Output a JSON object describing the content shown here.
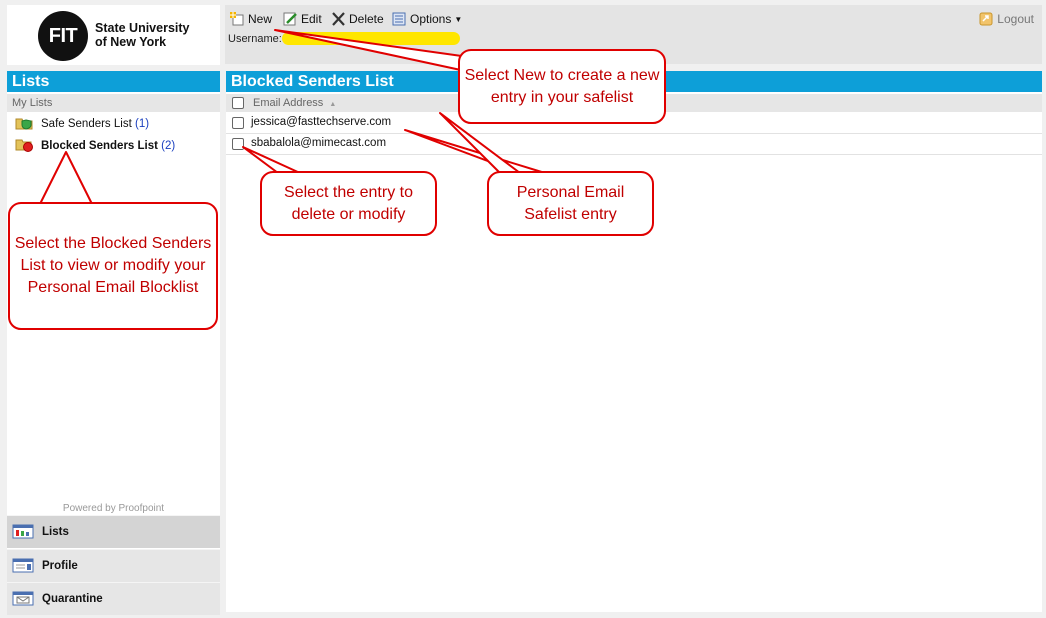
{
  "logo": {
    "mark": "FIT",
    "line1": "State University",
    "line2": "of New York"
  },
  "toolbar": {
    "new_label": "New",
    "edit_label": "Edit",
    "delete_label": "Delete",
    "options_label": "Options",
    "logout_label": "Logout",
    "username_label": "Username:"
  },
  "sidebar": {
    "title": "Lists",
    "section_label": "My Lists",
    "items": [
      {
        "label": "Safe Senders List",
        "count": "(1)",
        "icon": "shield-folder-icon"
      },
      {
        "label": "Blocked Senders List",
        "count": "(2)",
        "icon": "blocked-folder-icon"
      }
    ],
    "powered_by": "Powered by Proofpoint",
    "nav": [
      {
        "label": "Lists",
        "icon": "lists-icon"
      },
      {
        "label": "Profile",
        "icon": "profile-icon"
      },
      {
        "label": "Quarantine",
        "icon": "quarantine-icon"
      }
    ]
  },
  "main": {
    "title": "Blocked Senders List",
    "column_header": "Email Address",
    "sort_indicator": "▲",
    "entries": [
      "jessica@fasttechserve.com",
      "sbabalola@mimecast.com"
    ]
  },
  "annotations": {
    "new": "Select New to create a new entry in your safelist",
    "blocked": "Select the Blocked Senders List to view or modify your Personal Email Blocklist",
    "entry": "Select the entry to delete or modify",
    "safelist": "Personal Email Safelist entry"
  },
  "colors": {
    "accent": "#0d9fd8",
    "annotation": "#e00000",
    "highlight": "#ffe600"
  }
}
